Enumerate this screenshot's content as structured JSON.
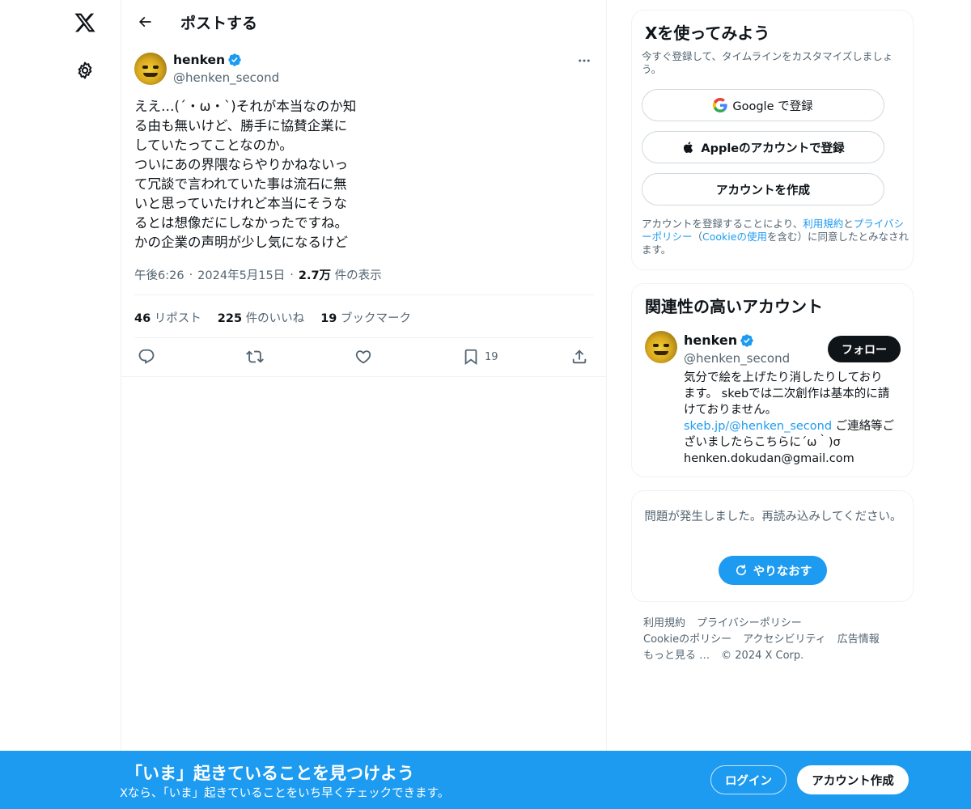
{
  "header": {
    "title": "ポストする"
  },
  "post": {
    "author_name": "henken",
    "author_handle": "@henken_second",
    "text_lines": [
      "ええ…(´・ω・`)それが本当なのか知",
      "る由も無いけど、勝手に協賛企業に",
      "していたってことなのか。",
      "ついにあの界隈ならやりかねないっ",
      "て冗談で言われていた事は流石に無",
      "いと思っていたけれど本当にそうな",
      "るとは想像だにしなかったですね。",
      "かの企業の声明が少し気になるけど"
    ],
    "time": "午後6:26",
    "date": "2024年5月15日",
    "views_count": "2.7万",
    "views_label": "件の表示",
    "separator": "·",
    "reposts_count": "46",
    "reposts_label": "リポスト",
    "likes_count": "225",
    "likes_label": "件のいいね",
    "bookmarks_count": "19",
    "bookmarks_label": "ブックマーク",
    "bookmark_action_count": "19"
  },
  "signup_card": {
    "title": "Xを使ってみよう",
    "subtitle": "今すぐ登録して、タイムラインをカスタマイズしましょう。",
    "google_label": "Google で登録",
    "apple_label": "Appleのアカウントで登録",
    "create_label": "アカウントを作成",
    "legal_1": "アカウントを登録することにより、",
    "legal_terms": "利用規約",
    "legal_2": "と",
    "legal_privacy": "プライバシーポリシー",
    "legal_3": "（",
    "legal_cookie": "Cookieの使用",
    "legal_4": "を含む）に同意したとみなされます。"
  },
  "related_card": {
    "title": "関連性の高いアカウント",
    "name": "henken",
    "handle": "@henken_second",
    "follow_label": "フォロー",
    "bio_1": "気分で絵を上げたり消したりしており",
    "bio_2": "ます。 skebでは二次創作は基本的に請",
    "bio_3": "けておりません。",
    "bio_link": "skeb.jp/@henken_second",
    "bio_4": " ご連絡等ご",
    "bio_5": "ざいましたらこちらに´ω｀)σ",
    "bio_6": "henken.dokudan@gmail.com"
  },
  "error_card": {
    "message": "問題が発生しました。再読み込みしてください。",
    "retry_label": "やりなおす"
  },
  "footer": {
    "terms": "利用規約",
    "privacy": "プライバシーポリシー",
    "cookie": "Cookieのポリシー",
    "accessibility": "アクセシビリティ",
    "ads": "広告情報",
    "more": "もっと見る …",
    "copyright": "© 2024 X Corp."
  },
  "bottom_bar": {
    "title": "「いま」起きていることを見つけよう",
    "subtitle": "Xなら、「いま」起きていることをいち早くチェックできます。",
    "login_label": "ログイン",
    "signup_label": "アカウント作成"
  },
  "colors": {
    "accent": "#1d9bf0",
    "text": "#0f1419",
    "secondary": "#536471",
    "border": "#eff3f4"
  },
  "icons": [
    "x-logo-icon",
    "settings-icon",
    "back-arrow-icon",
    "verified-badge-icon",
    "more-icon",
    "reply-icon",
    "repost-icon",
    "like-icon",
    "bookmark-icon",
    "share-icon",
    "google-icon",
    "apple-icon",
    "refresh-icon"
  ]
}
